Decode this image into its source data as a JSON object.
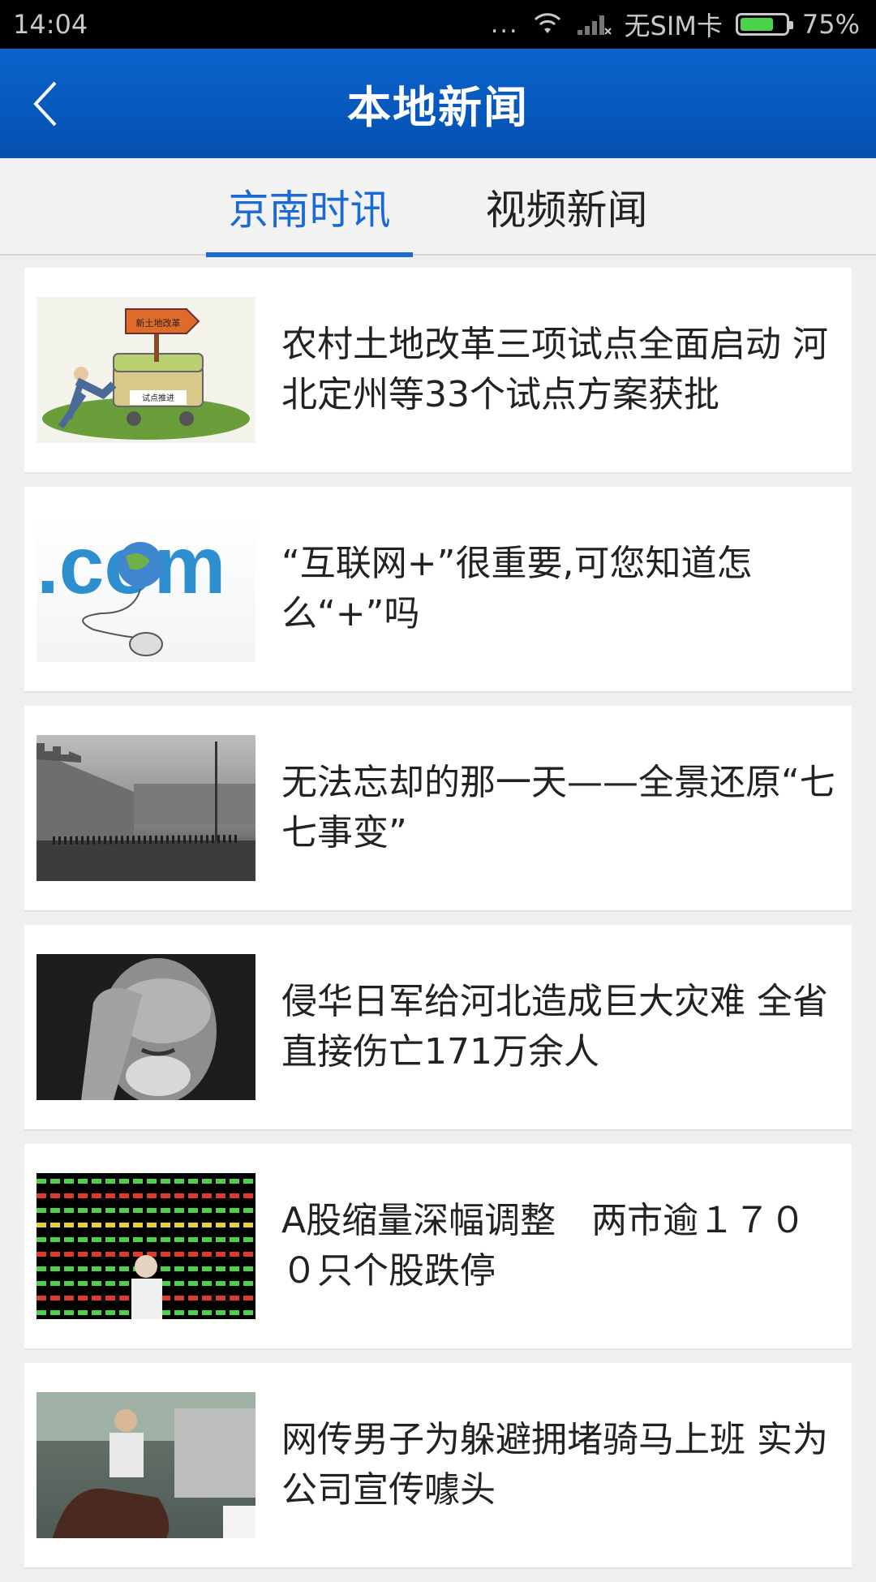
{
  "status_bar": {
    "time": "14:04",
    "dots": "...",
    "carrier": "无SIM卡",
    "battery": "75%",
    "battery_level": 0.75
  },
  "header": {
    "title": "本地新闻",
    "back_icon": "chevron-left-icon"
  },
  "tabs": [
    {
      "label": "京南时讯",
      "active": true
    },
    {
      "label": "视频新闻",
      "active": false
    }
  ],
  "news": [
    {
      "title": "农村土地改革三项试点全面启动 河北定州等33个试点方案获批",
      "thumb_sign": "新土地改革",
      "thumb_cart": "试点推进"
    },
    {
      "title": "“互联网+”很重要,可您知道怎么“+”吗",
      "thumb_text": ".com"
    },
    {
      "title": "无法忘却的那一天——全景还原“七七事变”"
    },
    {
      "title": "侵华日军给河北造成巨大灾难 全省直接伤亡171万余人"
    },
    {
      "title": "A股缩量深幅调整　两市逾１７００只个股跌停"
    },
    {
      "title": "网传男子为躲避拥堵骑马上班 实为公司宣传噱头"
    }
  ],
  "colors": {
    "header_blue": "#0a5bc4",
    "tab_active": "#1a6ad6",
    "battery_green": "#4cd14a"
  }
}
